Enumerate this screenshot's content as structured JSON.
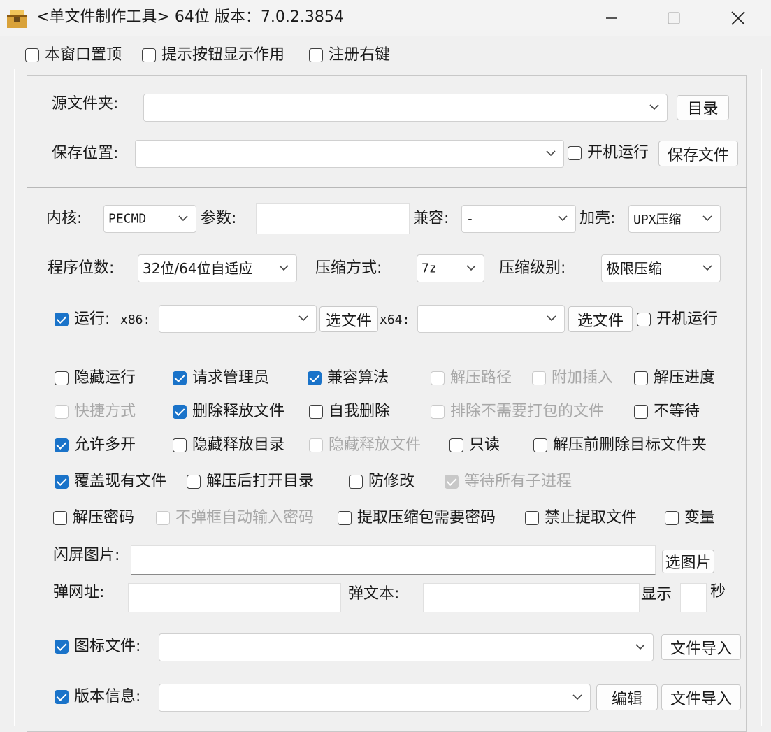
{
  "window": {
    "title": "<单文件制作工具> 64位 版本：7.0.2.3854",
    "minimize": "—",
    "maximize": "☐",
    "close": "✕"
  },
  "top_options": [
    {
      "label": "本窗口置顶",
      "checked": false
    },
    {
      "label": "提示按钮显示作用",
      "checked": false
    },
    {
      "label": "注册右键",
      "checked": false
    }
  ],
  "source": {
    "source_label": "源文件夹:",
    "source_value": "",
    "dir_button": "目录",
    "save_label": "保存位置:",
    "save_value": "",
    "autorun_label": "开机运行",
    "save_button": "保存文件"
  },
  "settings": {
    "kernel_label": "内核:",
    "kernel_value": "PECMD",
    "param_label": "参数:",
    "param_value": "",
    "compat_label": "兼容:",
    "compat_value": "-",
    "shell_label": "加壳:",
    "shell_value": "UPX压缩",
    "bits_label": "程序位数:",
    "bits_value": "32位/64位自适应",
    "compress_label": "压缩方式:",
    "compress_value": "7z",
    "level_label": "压缩级别:",
    "level_value": "极限压缩",
    "run_label": "运行:",
    "x86_label": "x86:",
    "x86_value": "",
    "select_file_1": "选文件",
    "x64_label": "x64:",
    "x64_value": "",
    "select_file_2": "选文件",
    "autorun2_label": "开机运行"
  },
  "options": {
    "hide_run": "隐藏运行",
    "request_admin": "请求管理员",
    "compat_algo": "兼容算法",
    "extract_path": "解压路径",
    "attach_insert": "附加插入",
    "extract_progress": "解压进度",
    "shortcut": "快捷方式",
    "delete_released": "删除释放文件",
    "self_delete": "自我删除",
    "exclude_files": "排除不需要打包的文件",
    "no_wait": "不等待",
    "allow_multi": "允许多开",
    "hide_release_dir": "隐藏释放目录",
    "hide_release_file": "隐藏释放文件",
    "read_only": "只读",
    "delete_target_before": "解压前删除目标文件夹",
    "overwrite": "覆盖现有文件",
    "open_dir_after": "解压后打开目录",
    "anti_modify": "防修改",
    "wait_children": "等待所有子进程",
    "extract_password": "解压密码",
    "auto_password": "不弹框自动输入密码",
    "need_password": "提取压缩包需要密码",
    "forbid_extract": "禁止提取文件",
    "variable": "变量",
    "splash_label": "闪屏图片:",
    "splash_value": "",
    "select_image": "选图片",
    "popup_url_label": "弹网址:",
    "popup_url_value": "",
    "popup_text_label": "弹文本:",
    "popup_text_value": "",
    "show_label": "显示",
    "show_value": "",
    "seconds_label": "秒"
  },
  "resources": {
    "icon_label": "图标文件:",
    "icon_value": "",
    "icon_import": "文件导入",
    "version_label": "版本信息:",
    "version_value": "",
    "edit_button": "编辑",
    "version_import": "文件导入"
  },
  "colors": {
    "checked": "#1a73c9",
    "disabled_text": "#a8a8a8",
    "background": "#f0f0f0"
  }
}
